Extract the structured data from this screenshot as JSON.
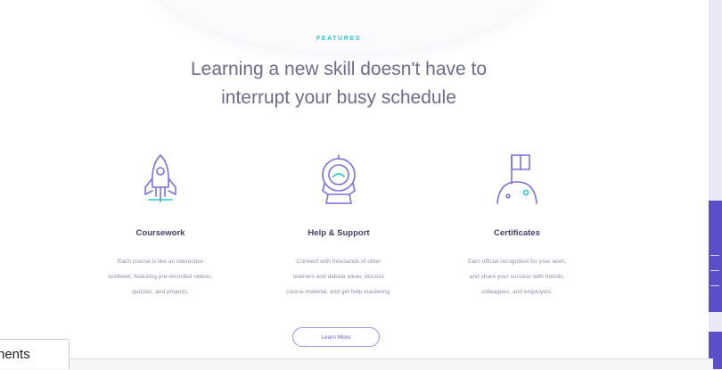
{
  "colors": {
    "accent_cyan": "#28c6d9",
    "accent_purple": "#6a5fd0",
    "heading": "#6b6b8c"
  },
  "features_section": {
    "kicker": "FEATURES",
    "headline_line1": "Learning a new skill doesn't have to",
    "headline_line2": "interrupt your busy schedule",
    "items": [
      {
        "icon": "rocket-icon",
        "title": "Coursework",
        "desc_lines": [
          "Each course is like an interactive",
          "textbook, featuring pre-recorded videos,",
          "quizzes, and projects."
        ]
      },
      {
        "icon": "astronaut-helmet-icon",
        "title": "Help & Support",
        "desc_lines": [
          "Connect with thousands of other",
          "learners and debate ideas, discuss",
          "course material, and get help mastering."
        ]
      },
      {
        "icon": "flag-planet-icon",
        "title": "Certificates",
        "desc_lines": [
          "Earn official recognition for your work,",
          "and share your success with friends,",
          "colleagues, and employers."
        ]
      }
    ],
    "cta_label": "Learn More"
  },
  "bottom_tab": {
    "label": "nents"
  }
}
